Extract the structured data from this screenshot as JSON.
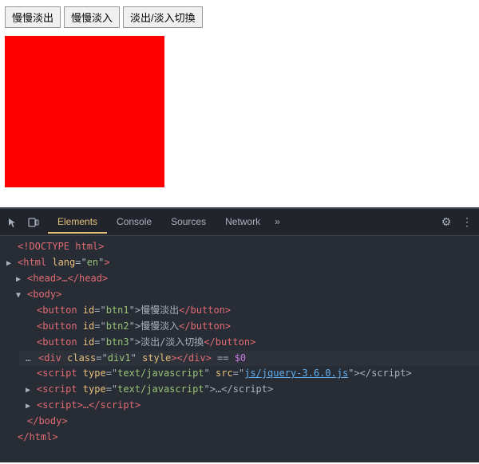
{
  "demo": {
    "buttons": [
      {
        "id": "btn1",
        "label": "慢慢淡出"
      },
      {
        "id": "btn2",
        "label": "慢慢淡入"
      },
      {
        "id": "btn3",
        "label": "淡出/淡入切換"
      }
    ]
  },
  "devtools": {
    "tabs": [
      {
        "label": "Elements",
        "active": true
      },
      {
        "label": "Console",
        "active": false
      },
      {
        "label": "Sources",
        "active": false
      },
      {
        "label": "Network",
        "active": false
      }
    ],
    "tab_more": "»",
    "code": {
      "doctype": "<!DOCTYPE html>",
      "html_open": "<html lang=\"en\">",
      "head": "<head>…</head>",
      "body_open": "<body>",
      "btn1": "<button id=\"btn1\">慢慢淡出</button>",
      "btn2": "<button id=\"btn2\">慢慢淡入</button>",
      "btn3": "<button id=\"btn3\">淡出/淡入切換</button>",
      "div": "<div class=\"div1\" style></div> == $0",
      "script1": "<script type=\"text/javascript\" src=\"js/jquery-3.6.0.js\"><\\/script>",
      "script2": "<script type=\"text/javascript\">…<\\/script>",
      "script3": "<script>…<\\/script>",
      "body_close": "</body>",
      "html_close": "</html>"
    }
  }
}
